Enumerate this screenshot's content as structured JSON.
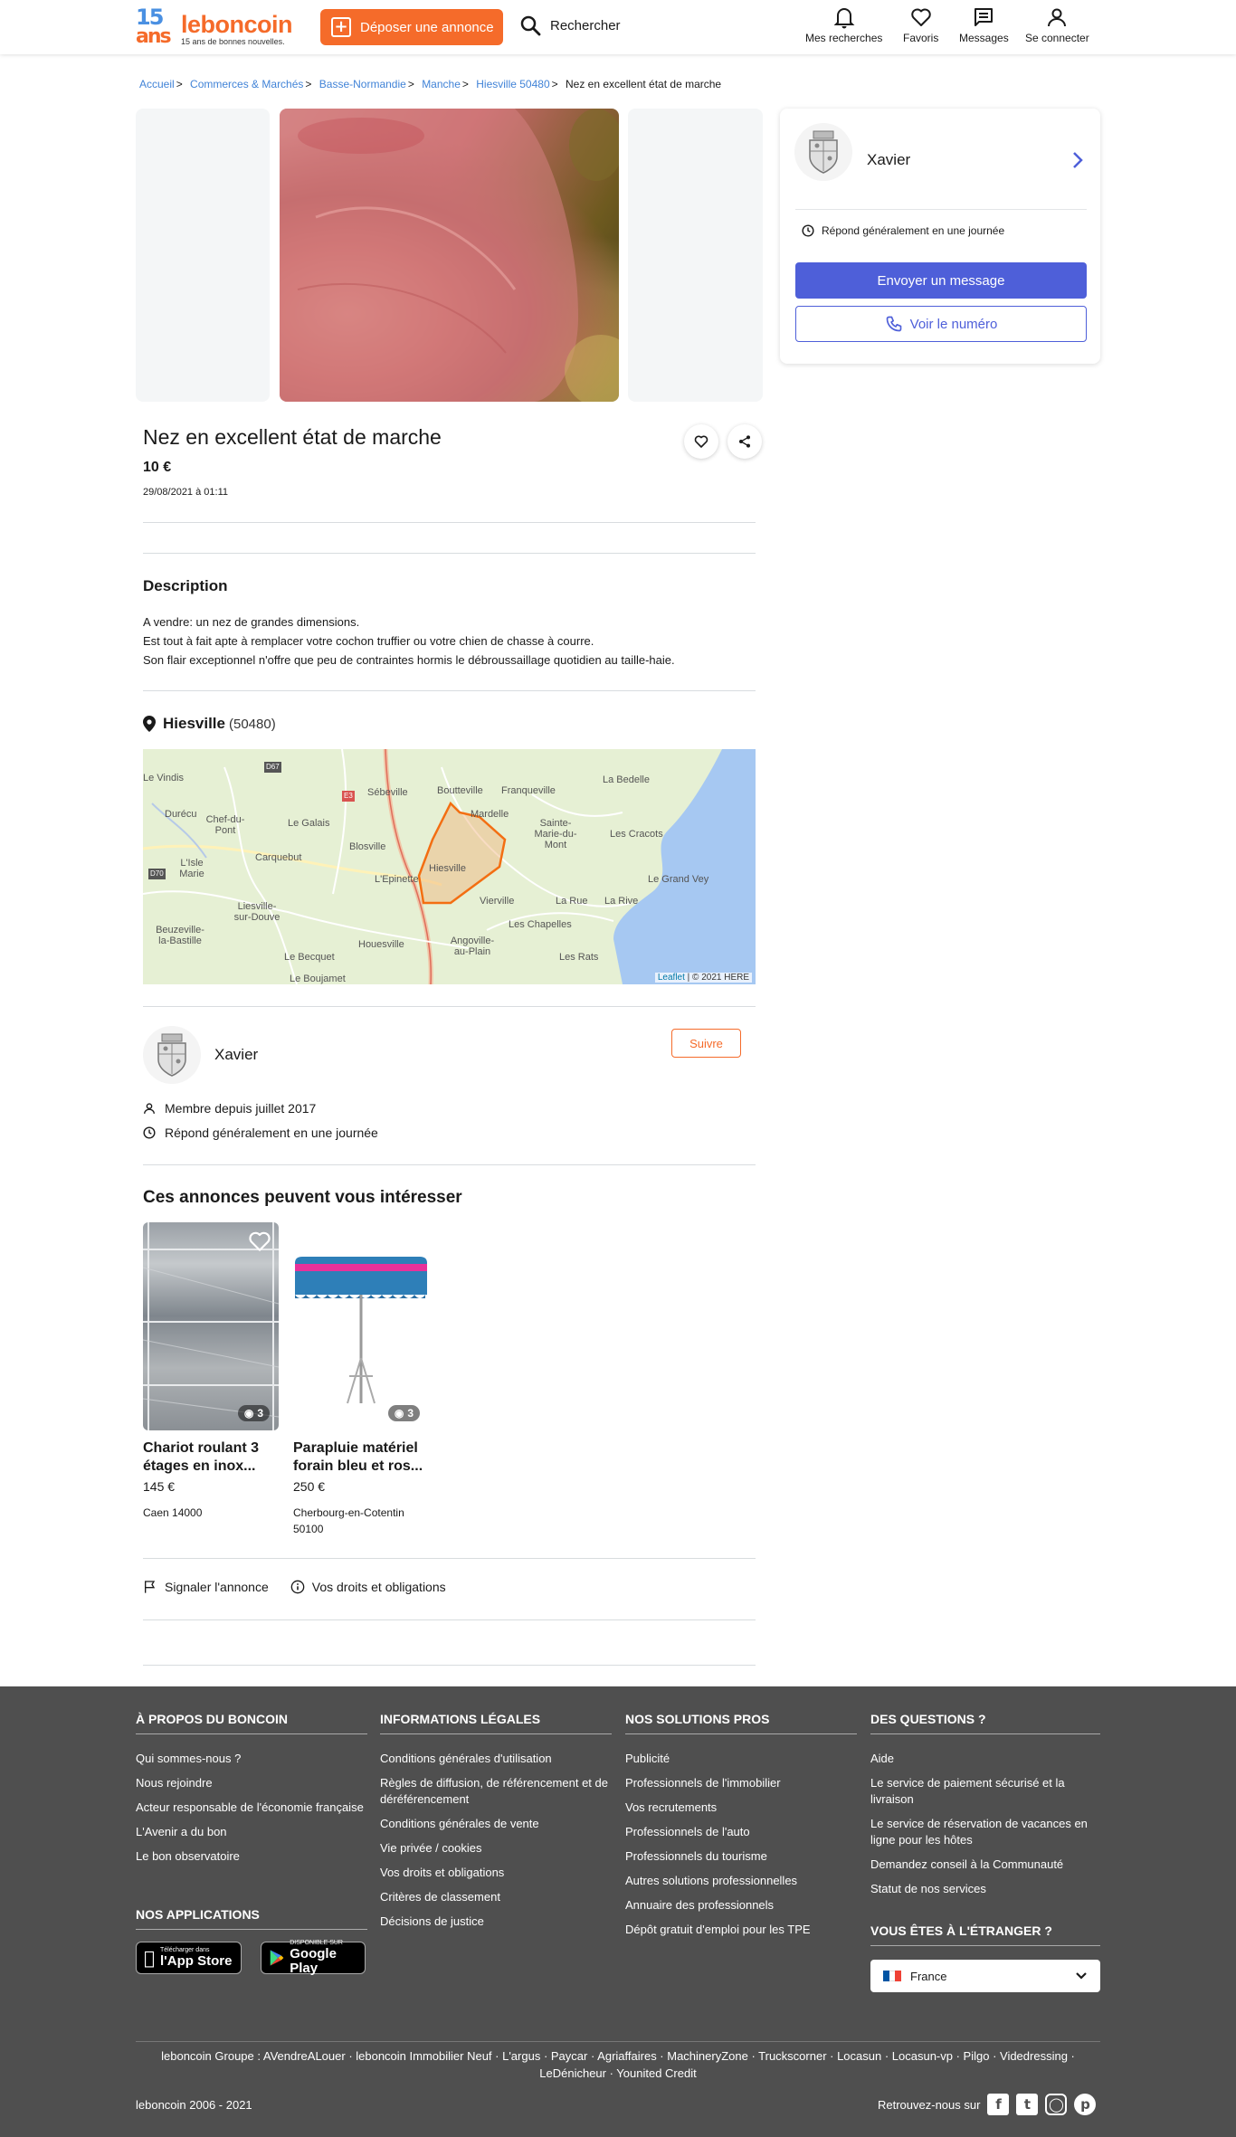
{
  "header": {
    "logo_number": "15",
    "logo_ans": "ans",
    "logo_brand": "leboncoin",
    "logo_tagline": "15 ans de bonnes nouvelles.",
    "deposit_label": "Déposer une annonce",
    "search_label": "Rechercher",
    "nav": [
      {
        "label": "Mes recherches",
        "icon": "bell-icon"
      },
      {
        "label": "Favoris",
        "icon": "heart-icon"
      },
      {
        "label": "Messages",
        "icon": "message-icon"
      },
      {
        "label": "Se connecter",
        "icon": "user-icon"
      }
    ]
  },
  "breadcrumb": [
    "Accueil",
    "Commerces & Marchés",
    "Basse-Normandie",
    "Manche",
    "Hiesville 50480"
  ],
  "breadcrumb_current": "Nez en excellent état de marche",
  "ad": {
    "title": "Nez en excellent état de marche",
    "price": "10 €",
    "date": "29/08/2021 à 01:11",
    "description_heading": "Description",
    "description_lines": [
      "A vendre: un nez de grandes dimensions.",
      "Est tout à fait apte à remplacer votre cochon truffier ou votre chien de chasse à courre.",
      "Son flair exceptionnel n'offre que peu de contraintes hormis le débroussaillage quotidien au taille-haie."
    ],
    "city": "Hiesville",
    "postcode": "(50480)"
  },
  "map": {
    "attribution_link": "Leaflet",
    "attribution_text": " | © 2021 HERE",
    "labels": [
      "Le Vindis",
      "Sébeville",
      "Boutteville",
      "Franqueville",
      "La Bedelle",
      "Durécu",
      "Chef-du-Pont",
      "Le Galais",
      "Mardelle",
      "Sainte-Marie-du-Mont",
      "Les Cracots",
      "Carquebut",
      "Blosville",
      "L'Isle Marie",
      "Hiesville",
      "L'Epinette",
      "Le Grand Vey",
      "Liesville-sur-Douve",
      "Vierville",
      "La Rue",
      "La Rive",
      "Beuzeville-la-Bastille",
      "Les Chapelles",
      "Houesville",
      "Angoville-au-Plain",
      "Le Becquet",
      "Les Rats",
      "Le Boujamet"
    ],
    "road_labels": [
      "D67",
      "D70",
      "E3"
    ]
  },
  "seller": {
    "name": "Xavier",
    "follow_label": "Suivre",
    "member_since": "Membre depuis juillet 2017",
    "response": "Répond généralement en une journée"
  },
  "sidecard": {
    "name": "Xavier",
    "response": "Répond généralement en une journée",
    "send_message": "Envoyer un message",
    "show_number": "Voir le numéro"
  },
  "similar": {
    "heading": "Ces annonces peuvent vous intéresser",
    "items": [
      {
        "title": "Chariot roulant 3 étages en inox...",
        "price": "145 €",
        "location": "Caen 14000",
        "photos": "3"
      },
      {
        "title": "Parapluie matériel forain bleu et ros...",
        "price": "250 €",
        "location": "Cherbourg-en-Cotentin 50100",
        "photos": "3"
      }
    ]
  },
  "actions": {
    "report": "Signaler l'annonce",
    "rights": "Vos droits et obligations"
  },
  "footer": {
    "cols": [
      {
        "title": "À PROPOS DU BONCOIN",
        "links": [
          "Qui sommes-nous ?",
          "Nous rejoindre",
          "Acteur responsable de l'économie française",
          "L'Avenir a du bon",
          "Le bon observatoire"
        ]
      },
      {
        "title": "INFORMATIONS LÉGALES",
        "links": [
          "Conditions générales d'utilisation",
          "Règles de diffusion, de référencement et de déréférencement",
          "Conditions générales de vente",
          "Vie privée / cookies",
          "Vos droits et obligations",
          "Critères de classement",
          "Décisions de justice"
        ]
      },
      {
        "title": "NOS SOLUTIONS PROS",
        "links": [
          "Publicité",
          "Professionnels de l'immobilier",
          "Vos recrutements",
          "Professionnels de l'auto",
          "Professionnels du tourisme",
          "Autres solutions professionnelles",
          "Annuaire des professionnels",
          "Dépôt gratuit d'emploi pour les TPE"
        ]
      },
      {
        "title": "DES QUESTIONS ?",
        "links": [
          "Aide",
          "Le service de paiement sécurisé et la livraison",
          "Le service de réservation de vacances en ligne pour les hôtes",
          "Demandez conseil à la Communauté",
          "Statut de nos services"
        ]
      }
    ],
    "apps_title": "NOS APPLICATIONS",
    "appstore_top": "Télécharger dans",
    "appstore_bottom": "l'App Store",
    "googleplay_top": "DISPONIBLE SUR",
    "googleplay_bottom": "Google Play",
    "abroad_title": "VOUS ÊTES À L'ÉTRANGER ?",
    "country": "France",
    "group_line1": "leboncoin Groupe : AVendreALouer · leboncoin Immobilier Neuf · L'argus · Paycar · Agriaffaires · MachineryZone · Truckscorner · Locasun · Locasun-vp · Pilgo · Videdressing ·",
    "group_line2": "LeDénicheur · Younited Credit",
    "copyright": "leboncoin 2006 - 2021",
    "social_label": "Retrouvez-nous sur"
  },
  "colors": {
    "brand": "#f56b2a",
    "primary_blue": "#4e5fd9",
    "link_blue": "#4183d7",
    "footer_bg": "#4f4f4f"
  }
}
